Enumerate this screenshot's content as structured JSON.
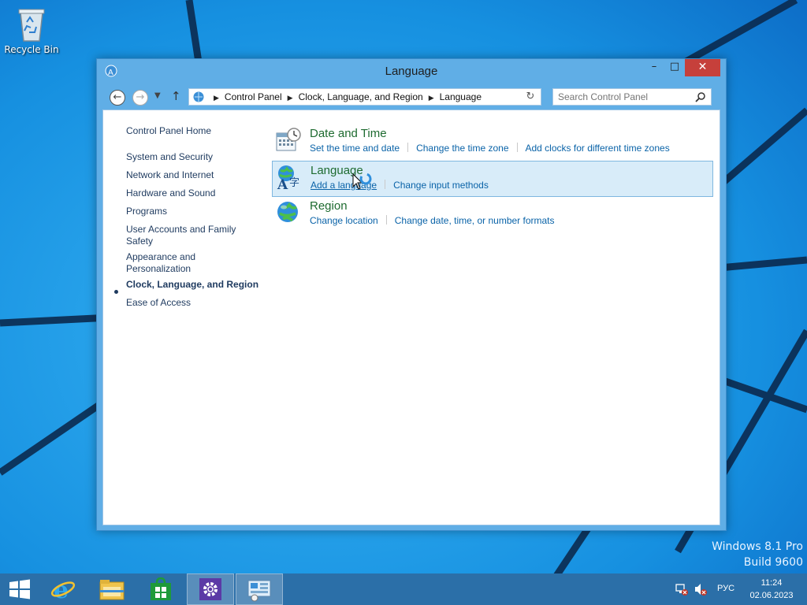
{
  "desktop": {
    "icons": [
      {
        "label": "Recycle Bin",
        "icon": "recycle-bin-icon"
      }
    ],
    "watermark": {
      "line1": "Windows 8.1 Pro",
      "line2": "Build 9600"
    }
  },
  "window": {
    "title": "Language",
    "controls": {
      "minimize": "–",
      "maximize": "□",
      "close": "✕"
    },
    "address_bar": {
      "crumbs": [
        "Control Panel",
        "Clock, Language, and Region",
        "Language"
      ]
    },
    "search": {
      "placeholder": "Search Control Panel"
    }
  },
  "sidebar": {
    "home": "Control Panel Home",
    "items": [
      {
        "label": "System and Security"
      },
      {
        "label": "Network and Internet"
      },
      {
        "label": "Hardware and Sound"
      },
      {
        "label": "Programs"
      },
      {
        "label": "User Accounts and Family Safety"
      },
      {
        "label": "Appearance and Personalization"
      },
      {
        "label": "Clock, Language, and Region",
        "active": true
      },
      {
        "label": "Ease of Access"
      }
    ]
  },
  "categories": [
    {
      "title": "Date and Time",
      "icon": "calendar-clock-icon",
      "links": [
        "Set the time and date",
        "Change the time zone",
        "Add clocks for different time zones"
      ]
    },
    {
      "title": "Language",
      "icon": "language-globe-icon",
      "highlighted": true,
      "links": [
        "Add a language",
        "Change input methods"
      ]
    },
    {
      "title": "Region",
      "icon": "region-globe-icon",
      "links": [
        "Change location",
        "Change date, time, or number formats"
      ]
    }
  ],
  "taskbar": {
    "apps": [
      "start-icon",
      "internet-explorer-icon",
      "file-explorer-icon",
      "store-icon",
      "settings-icon",
      "control-panel-icon"
    ],
    "tray": {
      "input_language": "РУС",
      "time": "11:24",
      "date": "02.06.2023"
    }
  },
  "colors": {
    "accent": "#1a8fe0",
    "link": "#0a63a8",
    "category_title": "#1e6b30",
    "close": "#c6403b"
  }
}
